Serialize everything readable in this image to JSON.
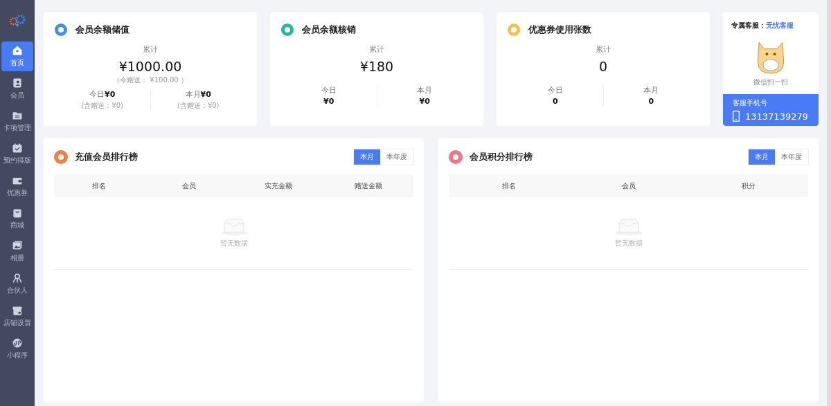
{
  "sidebar": {
    "items": [
      {
        "label": "首页",
        "selected": true
      },
      {
        "label": "会员",
        "selected": false
      },
      {
        "label": "卡项管理",
        "selected": false
      },
      {
        "label": "预约排版",
        "selected": false
      },
      {
        "label": "优惠券",
        "selected": false
      },
      {
        "label": "商城",
        "selected": false
      },
      {
        "label": "相册",
        "selected": false
      },
      {
        "label": "合伙人",
        "selected": false
      },
      {
        "label": "店铺设置",
        "selected": false
      },
      {
        "label": "小程序",
        "selected": false
      }
    ]
  },
  "stat_cards": [
    {
      "kind": "inline",
      "title": "会员余额储值",
      "color": "#3d8ef0",
      "total_label": "累计",
      "total": "¥1000.00",
      "note": "（今赠送： ¥100.00 ）",
      "periods": [
        {
          "label": "今日",
          "value": "¥0",
          "note": "(含赠送：¥0)"
        },
        {
          "label": "本月",
          "value": "¥0",
          "note": "(含赠送：¥0)"
        }
      ]
    },
    {
      "kind": "stacked",
      "title": "会员余额核销",
      "color": "#1bbf8f",
      "total_label": "累计",
      "total": "¥180",
      "periods": [
        {
          "label": "今日",
          "value": "¥0"
        },
        {
          "label": "本月",
          "value": "¥0"
        }
      ]
    },
    {
      "kind": "stacked",
      "title": "优惠券使用张数",
      "color": "#f5c04a",
      "total_label": "累计",
      "total": "0",
      "periods": [
        {
          "label": "今日",
          "value": "0"
        },
        {
          "label": "本月",
          "value": "0"
        }
      ]
    }
  ],
  "service": {
    "label": "专属客服：",
    "name": "无忧客服",
    "scan_caption": "微信扫一扫",
    "phone_label": "客服手机号",
    "phone": "13137139279"
  },
  "rankings": [
    {
      "title": "充值会员排行榜",
      "color": "#f57f3d",
      "tabs": [
        {
          "label": "本月",
          "selected": true
        },
        {
          "label": "本年度",
          "selected": false
        }
      ],
      "columns": [
        "排名",
        "会员",
        "实充金额",
        "赠送金额"
      ],
      "empty_text": "暂无数据"
    },
    {
      "title": "会员积分排行榜",
      "color": "#f2748a",
      "tabs": [
        {
          "label": "本月",
          "selected": true
        },
        {
          "label": "本年度",
          "selected": false
        }
      ],
      "columns": [
        "排名",
        "会员",
        "积分"
      ],
      "empty_text": "暂无数据"
    }
  ]
}
